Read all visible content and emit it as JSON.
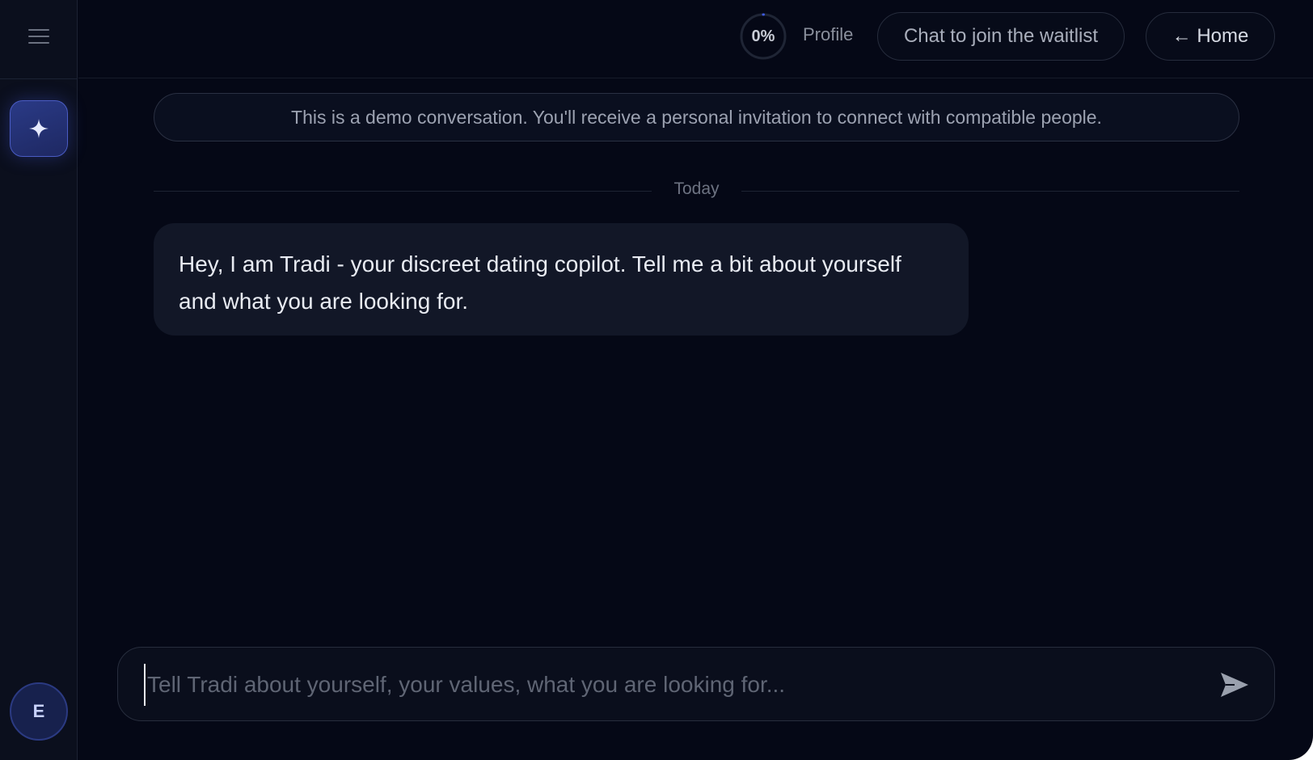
{
  "header": {
    "progress_percent": 0,
    "progress_text": "0%",
    "profile_label": "Profile",
    "waitlist_button": "Chat to join the waitlist",
    "home_button": "← Home"
  },
  "sidebar": {
    "menu_icon": "hamburger-menu-icon",
    "brand_icon": "sparkle-icon",
    "avatar_initial": "E"
  },
  "chat": {
    "notice": "This is a demo conversation. You'll receive a personal invitation to connect with compatible people.",
    "day_label": "Today",
    "messages": [
      {
        "sender": "assistant",
        "text": "Hey, I am Tradi - your discreet dating copilot. Tell me a bit about yourself and what you are looking for."
      }
    ]
  },
  "composer": {
    "value": "",
    "placeholder": "Tell Tradi about yourself, your values, what you are looking for...",
    "send_icon": "send-arrow-icon"
  },
  "colors": {
    "background": "#050816",
    "sidebar": "#0b0f1d",
    "accent": "#4a5cc4",
    "bubble": "#121727"
  }
}
